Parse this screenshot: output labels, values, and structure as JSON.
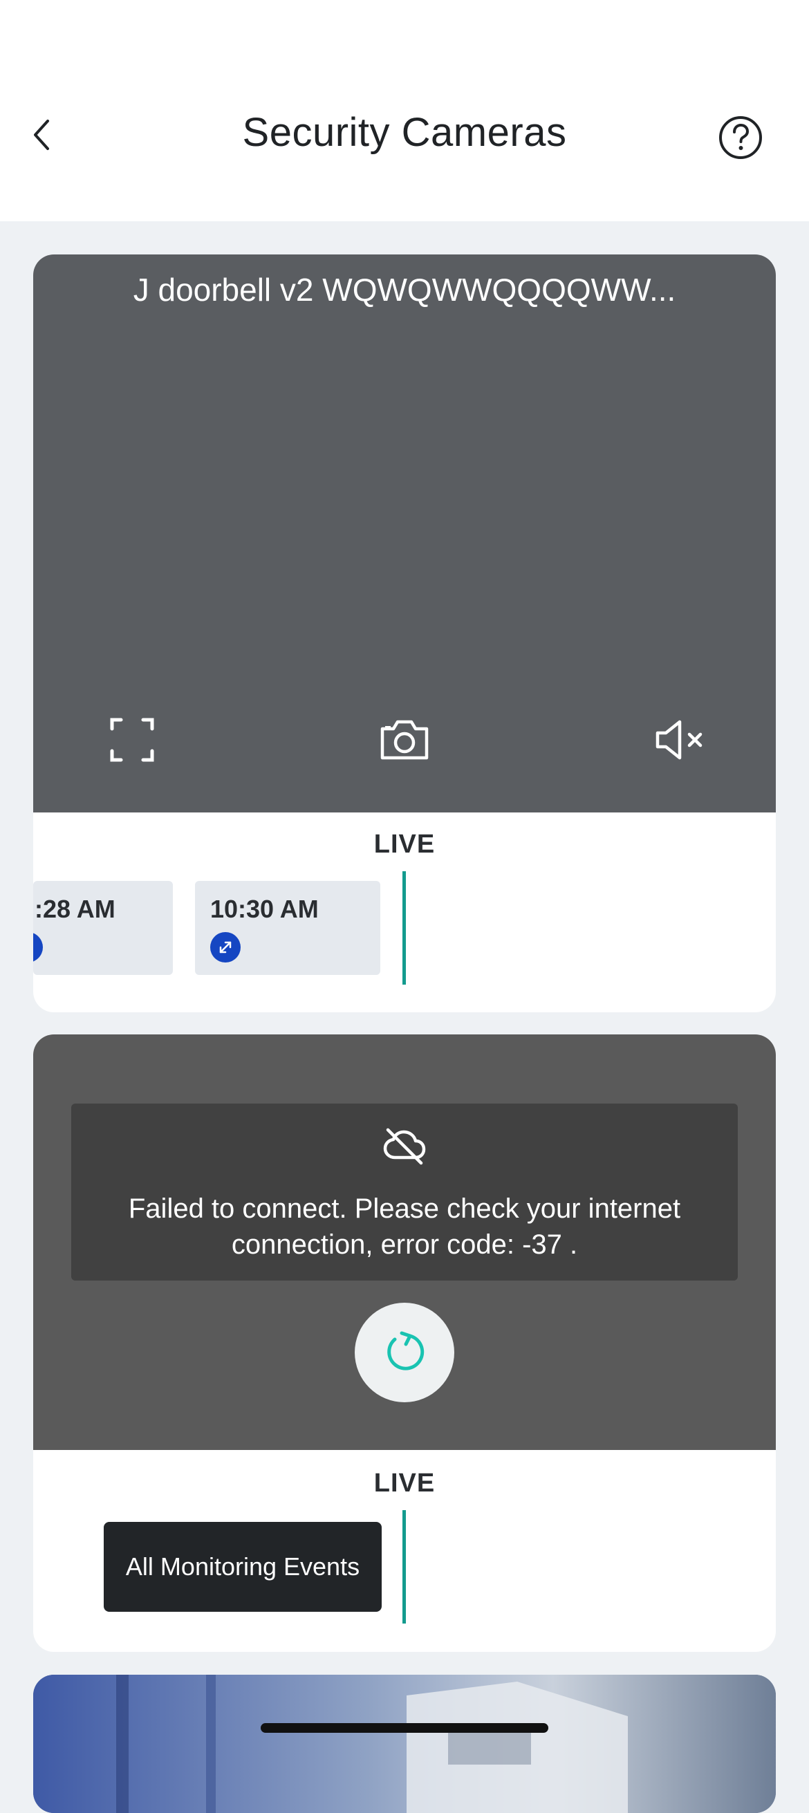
{
  "header": {
    "title": "Security Cameras"
  },
  "cameras": [
    {
      "name": "J doorbell v2 WQWQWWQQQQWW...",
      "status_label": "LIVE",
      "clips": [
        {
          "time": ":28 AM"
        },
        {
          "time": "10:30 AM"
        }
      ]
    },
    {
      "error_message": "Failed to connect. Please check your internet connection, error code: -37 .",
      "status_label": "LIVE",
      "events_button_label": "All Monitoring Events"
    }
  ],
  "colors": {
    "accent": "#139b8e",
    "badge": "#1546c2",
    "video_bg": "#5a5d61"
  }
}
